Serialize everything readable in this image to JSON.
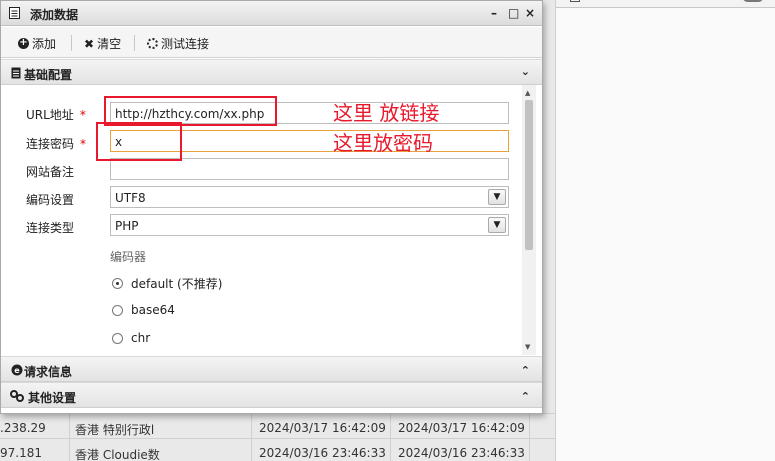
{
  "dialog": {
    "title": "添加数据",
    "controls": {
      "minimize": "–",
      "restore": "□",
      "close": "×"
    }
  },
  "toolbar": {
    "add_label": "添加",
    "clear_label": "清空",
    "test_label": "测试连接"
  },
  "sections": {
    "basic": "基础配置",
    "request": "请求信息",
    "other": "其他设置"
  },
  "form": {
    "url_label": "URL地址",
    "url_value": "http://hzthcy.com/xx.php",
    "password_label": "连接密码",
    "password_value": "x",
    "note_label": "网站备注",
    "note_value": "",
    "encoding_label": "编码设置",
    "encoding_value": "UTF8",
    "type_label": "连接类型",
    "type_value": "PHP",
    "required_mark": "*",
    "encoder_group_label": "编码器",
    "encoders": [
      {
        "label": "default (不推荐)",
        "selected": true
      },
      {
        "label": "base64",
        "selected": false
      },
      {
        "label": "chr",
        "selected": false
      }
    ]
  },
  "annotations": {
    "url_note": "这里 放链接",
    "password_note": "这里放密码"
  },
  "background_rows": [
    {
      "ip": ".238.29",
      "location": "香港 特别行政l",
      "created": "2024/03/17 16:42:09",
      "updated": "2024/03/17 16:42:09"
    },
    {
      "ip": "97.181",
      "location": "香港 Cloudie数",
      "created": "2024/03/16 23:46:33",
      "updated": "2024/03/16 23:46:33"
    }
  ],
  "colors": {
    "annotation_red": "#e8192c",
    "focus_border": "#e9a23b"
  }
}
